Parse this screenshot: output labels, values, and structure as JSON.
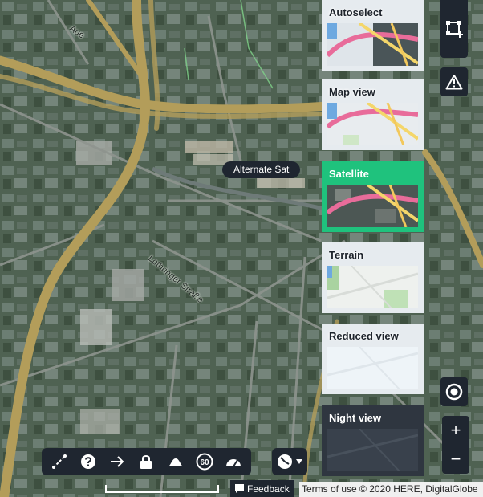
{
  "map": {
    "street_labels": [
      "Aue",
      "Lothringer Straße"
    ],
    "tooltip": "Alternate Sat"
  },
  "map_views": [
    {
      "label": "Autoselect",
      "selected": false
    },
    {
      "label": "Map view",
      "selected": false
    },
    {
      "label": "Satellite",
      "selected": true
    },
    {
      "label": "Terrain",
      "selected": false
    },
    {
      "label": "Reduced view",
      "selected": false
    },
    {
      "label": "Night view",
      "selected": false
    }
  ],
  "right_controls": {
    "draw_icon": "select-area-icon",
    "alert_icon": "warning-icon",
    "locate_icon": "locate-icon",
    "zoom_in": "+",
    "zoom_out": "−"
  },
  "toolbar": {
    "tools": [
      "route-icon",
      "help-icon",
      "arrow-icon",
      "lock-icon",
      "elevation-icon",
      "speed-limit-icon",
      "speedometer-icon"
    ],
    "speed_limit_text": "60"
  },
  "footer": {
    "feedback_label": "Feedback",
    "terms_text": "Terms of use © 2020 HERE, DigitalGlobe"
  },
  "colors": {
    "accent": "#1fc27d",
    "panel": "#1f2630",
    "road": "#b39d5a"
  }
}
